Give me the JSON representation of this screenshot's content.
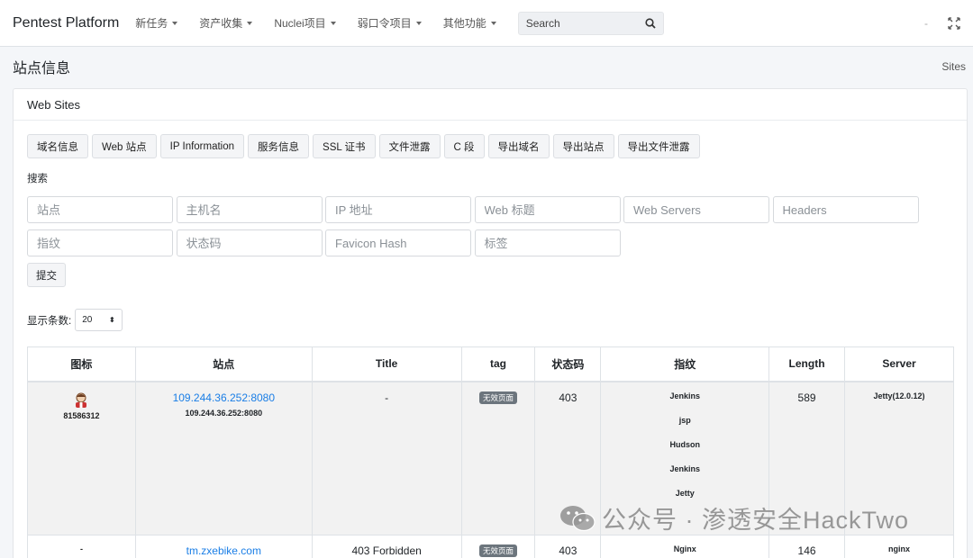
{
  "navbar": {
    "brand": "Pentest Platform",
    "menus": [
      "新任务",
      "资产收集",
      "Nuclei项目",
      "弱口令项目",
      "其他功能"
    ],
    "search_placeholder": "Search",
    "minus": "-"
  },
  "header": {
    "title": "站点信息",
    "breadcrumb": "Sites"
  },
  "card": {
    "title": "Web Sites",
    "buttons": [
      "域名信息",
      "Web 站点",
      "IP Information",
      "服务信息",
      "SSL 证书",
      "文件泄露",
      "C 段",
      "导出域名",
      "导出站点",
      "导出文件泄露"
    ],
    "search_label": "搜索",
    "fields": [
      "站点",
      "主机名",
      "IP 地址",
      "Web 标题",
      "Web Servers",
      "Headers",
      "指纹",
      "状态码",
      "Favicon Hash",
      "标签"
    ],
    "submit": "提交",
    "page_size_label": "显示条数:",
    "page_size_value": "20"
  },
  "table": {
    "headers": [
      "图标",
      "站点",
      "Title",
      "tag",
      "状态码",
      "指纹",
      "Length",
      "Server"
    ],
    "rows": [
      {
        "icon_hash": "81586312",
        "site": "109.244.36.252:8080",
        "site_sub": "109.244.36.252:8080",
        "title": "-",
        "tag": "无效页面",
        "status": "403",
        "fingerprints": [
          "Jenkins",
          "jsp",
          "Hudson",
          "Jenkins",
          "Jetty"
        ],
        "length": "589",
        "server": "Jetty(12.0.12)"
      },
      {
        "icon_hash": "-",
        "site": "tm.zxebike.com",
        "title": "403 Forbidden",
        "tag": "无效页面",
        "status": "403",
        "fingerprints": [
          "Nginx"
        ],
        "length": "146",
        "server": "nginx"
      }
    ]
  },
  "watermark": "公众号 · 渗透安全HackTwo"
}
